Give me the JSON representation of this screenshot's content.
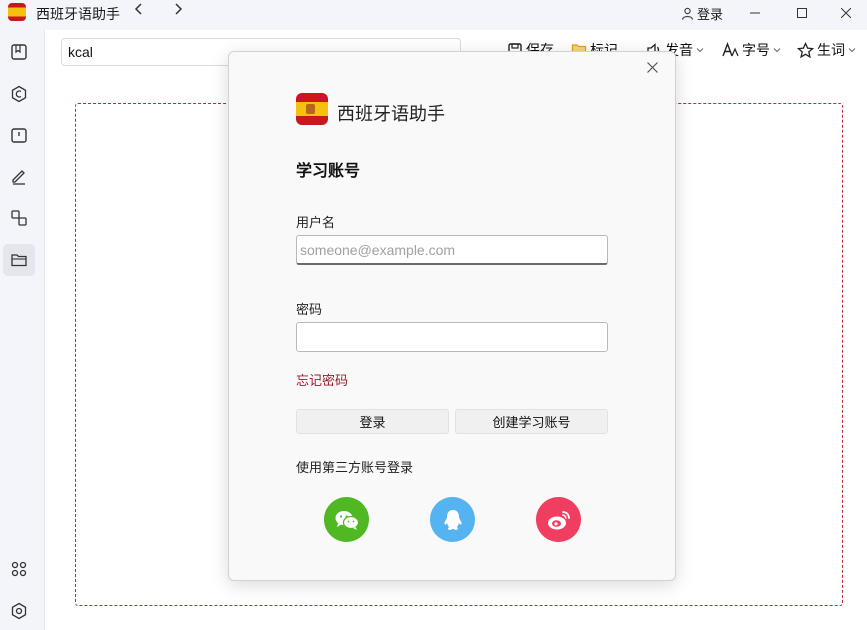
{
  "app": {
    "title": "西班牙语助手",
    "login_label": "登录"
  },
  "toolbar": {
    "search_value": "kcal",
    "items": [
      {
        "label": "保存",
        "icon": "save-icon"
      },
      {
        "label": "标记",
        "icon": "folder-icon"
      },
      {
        "label": "发音",
        "icon": "speaker-icon"
      },
      {
        "label": "字号",
        "icon": "font-size-icon"
      },
      {
        "label": "生词",
        "icon": "star-icon"
      }
    ]
  },
  "sidebar": {
    "items": [
      {
        "icon": "dictionary-icon"
      },
      {
        "icon": "conjugation-icon"
      },
      {
        "icon": "flashcard-icon"
      },
      {
        "icon": "edit-icon"
      },
      {
        "icon": "translate-icon"
      },
      {
        "icon": "folder-icon",
        "active": true
      },
      {
        "icon": "apps-icon"
      },
      {
        "icon": "settings-icon"
      }
    ]
  },
  "dialog": {
    "app_name": "西班牙语助手",
    "heading": "学习账号",
    "username_label": "用户名",
    "username_placeholder": "someone@example.com",
    "username_value": "",
    "password_label": "密码",
    "password_value": "",
    "forgot_label": "忘记密码",
    "login_button": "登录",
    "create_button": "创建学习账号",
    "third_party_label": "使用第三方账号登录",
    "social": [
      {
        "icon": "wechat-icon",
        "color": "#50b823"
      },
      {
        "icon": "qq-icon",
        "color": "#55b3f1"
      },
      {
        "icon": "weibo-icon",
        "color": "#ef3e5f"
      }
    ]
  },
  "colors": {
    "accent": "#c0283a",
    "forgot_link": "#9b1b2e"
  }
}
